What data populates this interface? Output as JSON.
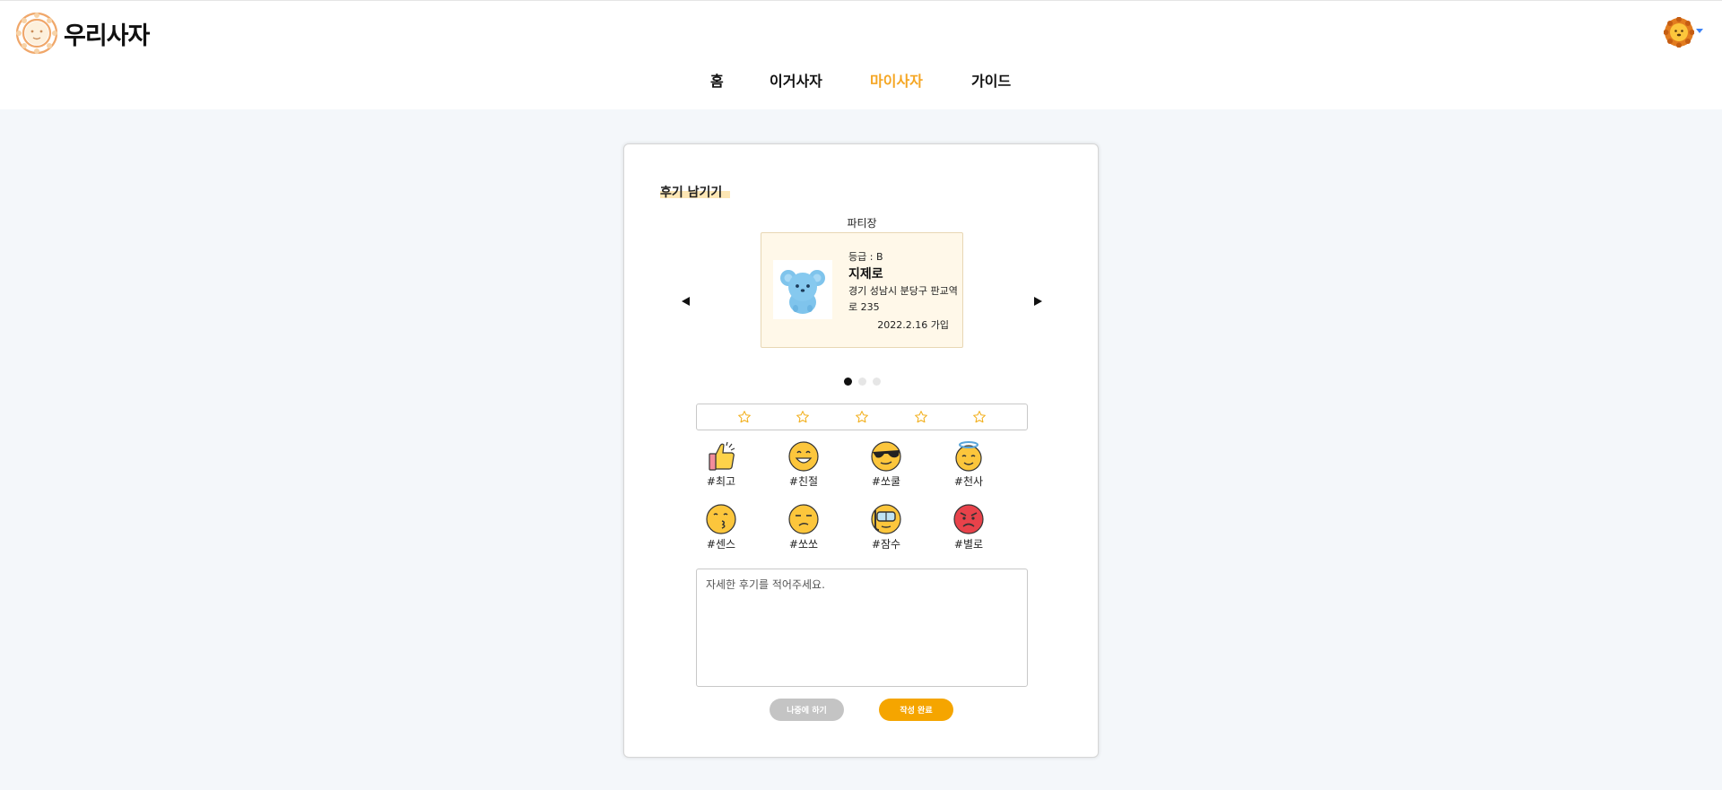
{
  "brand": {
    "name": "우리사자"
  },
  "nav": {
    "items": [
      "홈",
      "이거사자",
      "마이사자",
      "가이드"
    ],
    "active": "마이사자"
  },
  "review": {
    "title": "후기 남기기",
    "role_label": "파티장",
    "user": {
      "grade": "등급 : B",
      "name": "지제로",
      "address": "경기 성남시 분당구 판교역로 235",
      "joined": "2022.2.16 가입"
    },
    "carousel": {
      "count": 3,
      "active_index": 0
    },
    "rating": {
      "max": 5,
      "value": 0
    },
    "tags": [
      {
        "label": "#최고",
        "icon": "thumbs-up-icon"
      },
      {
        "label": "#친절",
        "icon": "grinning-face-icon"
      },
      {
        "label": "#쏘쿨",
        "icon": "sunglasses-face-icon"
      },
      {
        "label": "#천사",
        "icon": "halo-face-icon"
      },
      {
        "label": "#센스",
        "icon": "kissing-face-icon"
      },
      {
        "label": "#쏘쏘",
        "icon": "unamused-face-icon"
      },
      {
        "label": "#잠수",
        "icon": "snorkel-face-icon"
      },
      {
        "label": "#별로",
        "icon": "angry-face-icon"
      }
    ],
    "textarea_placeholder": "자세한 후기를 적어주세요.",
    "buttons": {
      "later": "나중에 하기",
      "submit": "작성 완료"
    }
  },
  "colors": {
    "accent": "#f5a623",
    "submit": "#f5a500",
    "later": "#c4c4c4",
    "card_bg": "#fff8e9",
    "page_bg": "#f4f7fa"
  }
}
